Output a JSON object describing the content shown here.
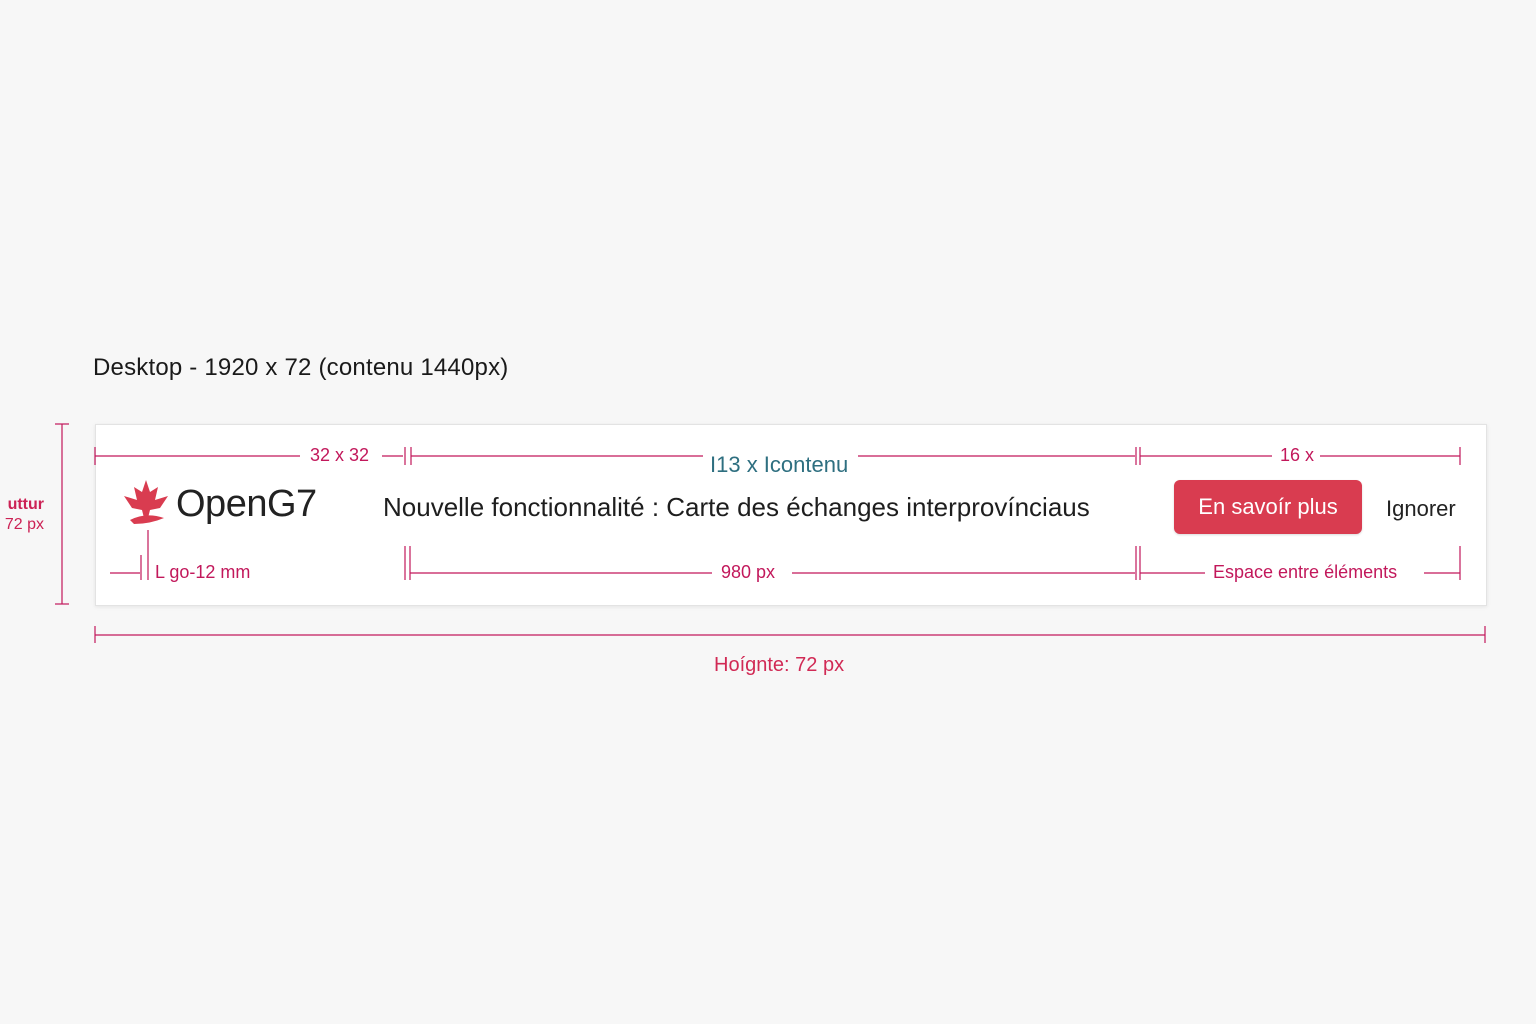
{
  "spec": {
    "title": "Desktop - 1920 x 72 (contenu 1440px)",
    "left_label_top": "uttur",
    "left_label_bottom": "72 px"
  },
  "banner": {
    "logo_text": "OpenG7",
    "logo_icon": "maple-leaf-icon",
    "message": "Nouvelle fonctionnalité : Carte des échanges interprovínciaus",
    "cta_label": "En savoír plus",
    "dismiss_label": "Ignorer"
  },
  "dimensions": {
    "logo_size": "32 x 32",
    "content_label": "I13 x Icontenu",
    "actions_label": "16 x",
    "logo_margin": "L go-12 mm",
    "content_width": "980 px",
    "actions_spacing": "Espace entre éléments",
    "height_label": "Hoígnte: 72 px"
  },
  "colors": {
    "accent": "#d93c50",
    "measure": "#c2185b",
    "teal": "#2e6f80",
    "background": "#f7f7f7"
  }
}
